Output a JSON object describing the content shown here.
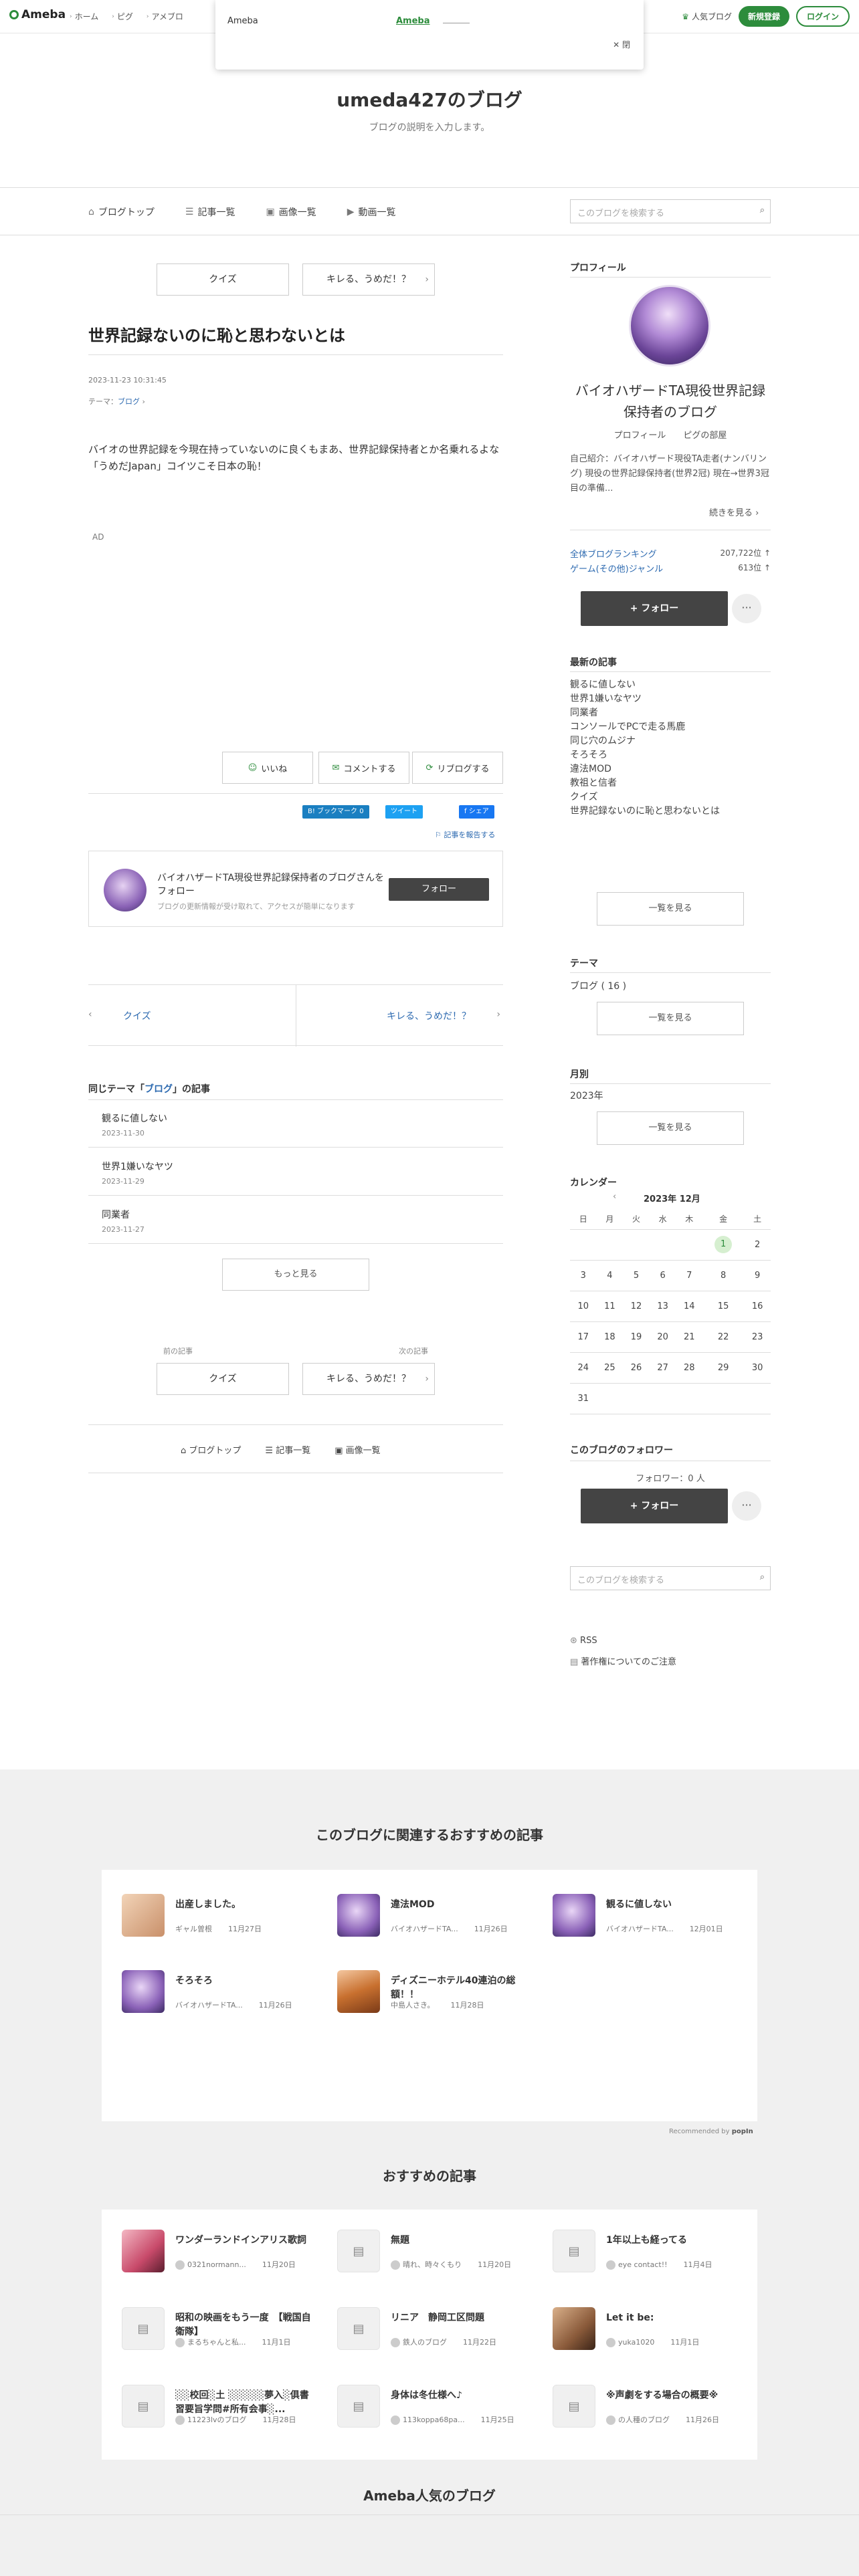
{
  "topbar": {
    "logo": "Ameba",
    "nav": [
      "ホーム",
      "ピグ",
      "アメブロ"
    ],
    "popup": {
      "label": "Ameba",
      "link": "Ameba",
      "close": "✕ 閉"
    },
    "popular": "人気ブログ",
    "signup": "新規登録",
    "login": "ログイン"
  },
  "blog": {
    "title": "umeda427のブログ",
    "description": "ブログの説明を入力します。"
  },
  "blognav": {
    "items": [
      "ブログトップ",
      "記事一覧",
      "画像一覧",
      "動画一覧"
    ],
    "search_placeholder": "このブログを検索する"
  },
  "article": {
    "prev_top": "クイズ",
    "next_top": "キレる、うめだ！？",
    "title": "世界記録ないのに恥と思わないとは",
    "date": "2023-11-23 10:31:45",
    "theme_label": "テーマ：",
    "theme": "ブログ",
    "body1": "バイオの世界記録を今現在持っていないのに良くもまあ、世界記録保持者とか名乗れるよな",
    "body2": "「うめだJapan」コイツこそ日本の恥！",
    "ad": "AD",
    "like": "いいね",
    "comment": "コメントする",
    "reblog": "リブログする",
    "hatena": "B! ブックマーク",
    "hatena_count": "0",
    "tweet": "ツイート",
    "fb": "シェア",
    "report": "記事を報告する"
  },
  "followbox": {
    "text": "バイオハザードTA現役世界記録保持者のブログさんをフォロー",
    "sub": "ブログの更新情報が受け取れて、アクセスが簡単になります",
    "button": "フォロー"
  },
  "pager": {
    "prev": "クイズ",
    "next": "キレる、うめだ！？"
  },
  "related": {
    "title_pre": "同じテーマ「",
    "theme": "ブログ",
    "title_post": "」の記事",
    "items": [
      {
        "title": "観るに値しない",
        "date": "2023-11-30"
      },
      {
        "title": "世界1嫌いなヤツ",
        "date": "2023-11-29"
      },
      {
        "title": "同業者",
        "date": "2023-11-27"
      }
    ],
    "more": "もっと見る"
  },
  "bottompager": {
    "prev_label": "前の記事",
    "next_label": "次の記事",
    "prev": "クイズ",
    "next": "キレる、うめだ！？"
  },
  "footnav": [
    "ブログトップ",
    "記事一覧",
    "画像一覧"
  ],
  "sidebar": {
    "profile_title": "プロフィール",
    "name": "バイオハザードTA現役世界記録保持者のブログ",
    "links": [
      "プロフィール",
      "ピグの部屋"
    ],
    "intro": "自己紹介：バイオハザード現役TA走者(ナンバリング) 現役の世界記録保持者(世界2冠) 現在→世界3冠目の準備...",
    "more": "続きを見る",
    "rank1_label": "全体ブログランキング",
    "rank1_value": "207,722位 ↑",
    "rank2_label": "ゲーム(その他)ジャンル",
    "rank2_value": "613位 ↑",
    "follow": "+ フォロー",
    "latest_title": "最新の記事",
    "latest": [
      "観るに値しない",
      "世界1嫌いなヤツ",
      "同業者",
      "コンソールでPCで走る馬鹿",
      "同じ穴のムジナ",
      "そろそろ",
      "違法MOD",
      "教祖と信者",
      "クイズ",
      "世界記録ないのに恥と思わないとは"
    ],
    "list_btn": "一覧を見る",
    "theme_title": "テーマ",
    "theme_item": "ブログ ( 16 )",
    "monthly_title": "月別",
    "monthly_item": "2023年",
    "calendar_title": "カレンダー",
    "calendar_month": "2023年 12月",
    "weekdays": [
      "日",
      "月",
      "火",
      "水",
      "木",
      "金",
      "土"
    ],
    "weeks": [
      [
        "",
        "",
        "",
        "",
        "",
        "1",
        "2"
      ],
      [
        "3",
        "4",
        "5",
        "6",
        "7",
        "8",
        "9"
      ],
      [
        "10",
        "11",
        "12",
        "13",
        "14",
        "15",
        "16"
      ],
      [
        "17",
        "18",
        "19",
        "20",
        "21",
        "22",
        "23"
      ],
      [
        "24",
        "25",
        "26",
        "27",
        "28",
        "29",
        "30"
      ],
      [
        "31",
        "",
        "",
        "",
        "",
        "",
        ""
      ]
    ],
    "follower_title": "このブログのフォロワー",
    "follower_count": "フォロワー：0 人",
    "search_placeholder": "このブログを検索する",
    "rss": "RSS",
    "copyright": "著作権についてのご注意"
  },
  "recommend": {
    "title": "このブログに関連するおすすめの記事",
    "cards": [
      {
        "title": "出産しました。",
        "author": "ギャル曽根",
        "date": "11月27日"
      },
      {
        "title": "違法MOD",
        "author": "バイオハザードTA...",
        "date": "11月26日"
      },
      {
        "title": "観るに値しない",
        "author": "バイオハザードTA...",
        "date": "12月01日"
      },
      {
        "title": "そろそろ",
        "author": "バイオハザードTA...",
        "date": "11月26日"
      },
      {
        "title": "ディズニーホテル40連泊の総額！！",
        "author": "中島人さき。",
        "date": "11月28日"
      }
    ],
    "credit": "Recommended by",
    "credit_brand": "popIn"
  },
  "osusume": {
    "title": "おすすめの記事",
    "cards": [
      {
        "title": "ワンダーランドインアリス歌詞",
        "author": "0321normann...",
        "date": "11月20日"
      },
      {
        "title": "無題",
        "author": "晴れ、時々くもり",
        "date": "11月20日"
      },
      {
        "title": "1年以上も経ってる",
        "author": "eye contact!!",
        "date": "11月4日"
      },
      {
        "title": "昭和の映画をもう一度　【戦国自衛隊】",
        "author": "まるちゃんと私...",
        "date": "11月1日"
      },
      {
        "title": "リニア　静岡工区問題",
        "author": "鉄人のブログ",
        "date": "11月22日"
      },
      {
        "title": "Let it be:",
        "author": "yuka1020",
        "date": "11月1日"
      },
      {
        "title": "░░校回░土 ░░░░░夢入░俱書習要旨学問#所有会事░...",
        "author": "11223lvのブログ",
        "date": "11月28日"
      },
      {
        "title": "身体は冬仕様へ♪",
        "author": "113koppa68pa...",
        "date": "11月25日"
      },
      {
        "title": "※声劇をする場合の概要※",
        "author": "の人種のブログ",
        "date": "11月26日"
      }
    ]
  },
  "footer_title": "Ameba人気のブログ"
}
